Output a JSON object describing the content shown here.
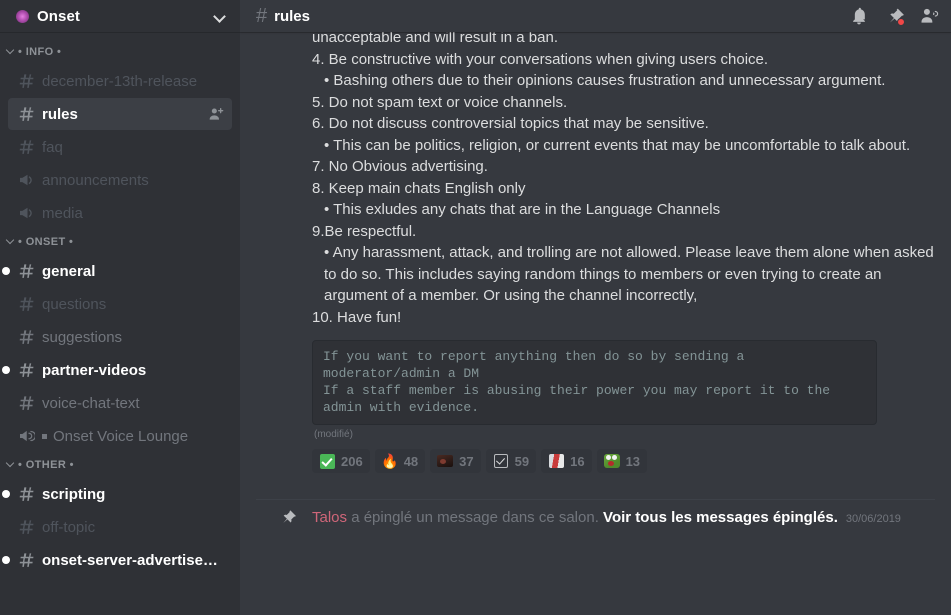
{
  "server": {
    "name": "Onset",
    "icon": "server-badge-icon",
    "collapse_icon": "chevron-down-icon"
  },
  "sidebar": {
    "categories": [
      {
        "label": "• INFO •",
        "channels": [
          {
            "name": "december-13th-release",
            "type": "text",
            "state": "muted"
          },
          {
            "name": "rules",
            "type": "text",
            "state": "active",
            "action_icon": "add-member-icon"
          },
          {
            "name": "faq",
            "type": "text",
            "state": "muted"
          },
          {
            "name": "announcements",
            "type": "announcement",
            "state": "muted"
          },
          {
            "name": "media",
            "type": "announcement",
            "state": "muted"
          }
        ]
      },
      {
        "label": "• ONSET •",
        "channels": [
          {
            "name": "general",
            "type": "text",
            "state": "unread"
          },
          {
            "name": "questions",
            "type": "text",
            "state": "muted"
          },
          {
            "name": "suggestions",
            "type": "text",
            "state": "read"
          },
          {
            "name": "partner-videos",
            "type": "text",
            "state": "unread"
          },
          {
            "name": "voice-chat-text",
            "type": "text",
            "state": "read"
          },
          {
            "name": "Onset Voice Lounge",
            "type": "voice",
            "state": "read"
          }
        ]
      },
      {
        "label": "• OTHER •",
        "channels": [
          {
            "name": "scripting",
            "type": "text",
            "state": "unread"
          },
          {
            "name": "off-topic",
            "type": "text",
            "state": "muted"
          },
          {
            "name": "onset-server-advertisem...",
            "type": "text",
            "state": "unread"
          }
        ]
      }
    ]
  },
  "topbar": {
    "hash": "#",
    "title": "rules",
    "icons": [
      {
        "name": "notifications-bell-icon"
      },
      {
        "name": "pinned-messages-icon",
        "badge": true
      },
      {
        "name": "member-list-icon"
      }
    ]
  },
  "message": {
    "lines": [
      {
        "text": "unacceptable and will result in a ban.",
        "indent": false
      },
      {
        "text": "4. Be constructive with your conversations when giving users choice.",
        "indent": false
      },
      {
        "text": "• Bashing others due to their opinions causes frustration and unnecessary argument.",
        "indent": true
      },
      {
        "text": "5. Do not spam text or voice channels.",
        "indent": false
      },
      {
        "text": "6. Do not discuss controversial topics that may be sensitive.",
        "indent": false
      },
      {
        "text": "• This can be politics, religion, or current events that may be uncomfortable to talk about.",
        "indent": true
      },
      {
        "text": "7. No Obvious advertising.",
        "indent": false
      },
      {
        "text": "8. Keep main chats English only",
        "indent": false
      },
      {
        "text": "• This exludes any chats that are in the Language Channels",
        "indent": true
      },
      {
        "text": "9.Be respectful.",
        "indent": false
      },
      {
        "text": "• Any harassment, attack, and trolling are not allowed. Please leave them alone when asked to do so. This includes saying random things to members or even trying to create an argument of a member. Or using the channel incorrectly,",
        "indent": true
      },
      {
        "text": "10. Have fun!",
        "indent": false
      }
    ],
    "codeblock": "If you want to report anything then do so by sending a moderator/admin a DM\nIf a staff member is abusing their power you may report it to the admin with evidence.",
    "edited_label": "(modifié)",
    "reactions": [
      {
        "emoji": "white-check-mark-emoji",
        "count": "206",
        "style": "check"
      },
      {
        "emoji": "fire-emoji",
        "count": "48",
        "style": "fire",
        "glyph": "🔥"
      },
      {
        "emoji": "custom-dark-emoji",
        "count": "37",
        "style": "dark"
      },
      {
        "emoji": "ballot-box-with-check-emoji",
        "count": "59",
        "style": "ballot"
      },
      {
        "emoji": "custom-red-white-emoji",
        "count": "16",
        "style": "redwhite"
      },
      {
        "emoji": "custom-green-pepe-emoji",
        "count": "13",
        "style": "pepe"
      }
    ]
  },
  "pin_notice": {
    "icon": "pin-icon",
    "user": "Talos",
    "text_before": " a épinglé un message dans ce salon. ",
    "link": "Voir tous les messages épinglés.",
    "timestamp": "30/06/2019"
  },
  "colors": {
    "sidebar_bg": "#2f3136",
    "main_bg": "#36393f",
    "accent_red": "#f04747",
    "user_name": "#cf6679",
    "text_primary": "#dcddde",
    "text_muted": "#72767d"
  }
}
